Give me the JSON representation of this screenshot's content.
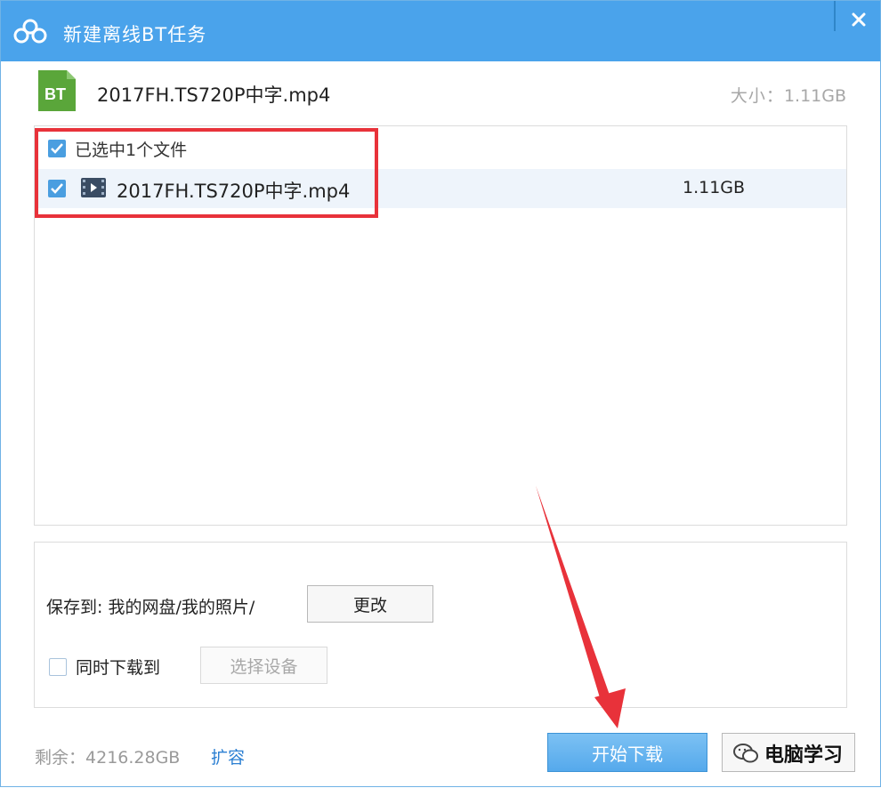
{
  "window": {
    "title": "新建离线BT任务",
    "close_glyph": "×"
  },
  "torrent": {
    "icon_label": "BT",
    "name": "2017FH.TS720P中字.mp4",
    "size_label": "大小：",
    "size_value": "1.11GB"
  },
  "file_list": {
    "header_label": "已选中1个文件",
    "header_checked": true,
    "rows": [
      {
        "name": "2017FH.TS720P中字.mp4",
        "size": "1.11GB",
        "checked": true,
        "icon": "video-icon"
      }
    ]
  },
  "save": {
    "label": "保存到: 我的网盘/我的照片/",
    "change_button": "更改",
    "sync_label": "同时下载到",
    "sync_checked": false,
    "device_button": "选择设备"
  },
  "footer": {
    "remaining_label": "剩余：",
    "remaining_value": "4216.28GB",
    "expand_link": "扩容",
    "start_button": "开始下载"
  },
  "watermark": {
    "text": "电脑学习"
  },
  "colors": {
    "titlebar": "#4aa3eb",
    "accent": "#4a9ee0",
    "bt_icon": "#5aa63a",
    "highlight": "#e8323a",
    "link": "#2b7fd2"
  }
}
